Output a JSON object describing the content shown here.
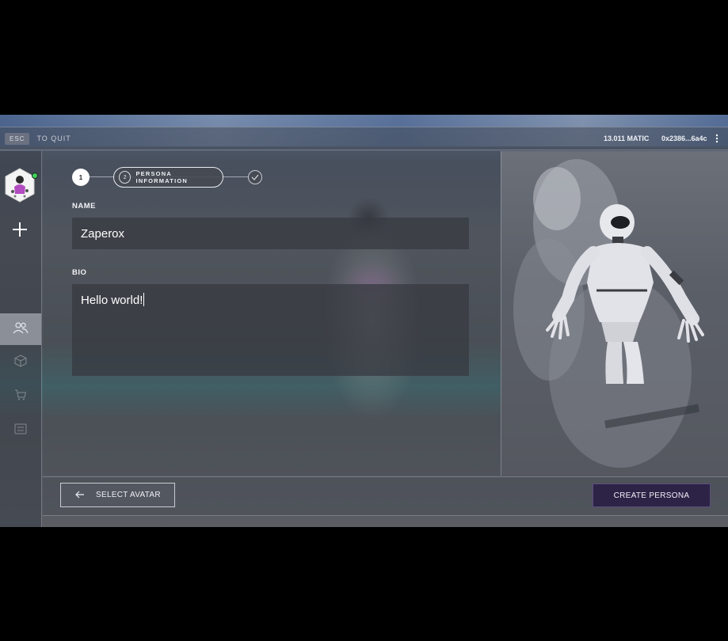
{
  "topbar": {
    "esc_key": "ESC",
    "quit_text": "TO QUIT",
    "balance": "13.011 MATIC",
    "wallet_address": "0x2386...6a4c",
    "menu_icon": "more-vertical-icon"
  },
  "sidebar": {
    "avatar": "avatar",
    "status_color": "#3ed15a",
    "add_icon": "plus-icon",
    "nav": [
      {
        "name": "personas",
        "icon": "users-icon",
        "active": true
      },
      {
        "name": "inventory",
        "icon": "cube-icon",
        "active": false
      },
      {
        "name": "store",
        "icon": "cart-icon",
        "active": false
      },
      {
        "name": "list",
        "icon": "list-icon",
        "active": false
      }
    ]
  },
  "stepper": {
    "step1": "1",
    "step2_number": "2",
    "step2_label": "PERSONA INFORMATION",
    "step3_icon": "check-icon"
  },
  "form": {
    "name_label": "NAME",
    "name_value": "Zaperox",
    "bio_label": "BIO",
    "bio_value": "Hello world!"
  },
  "footer": {
    "back_label": "SELECT AVATAR",
    "create_label": "CREATE PERSONA",
    "create_color": "#2d2346"
  }
}
